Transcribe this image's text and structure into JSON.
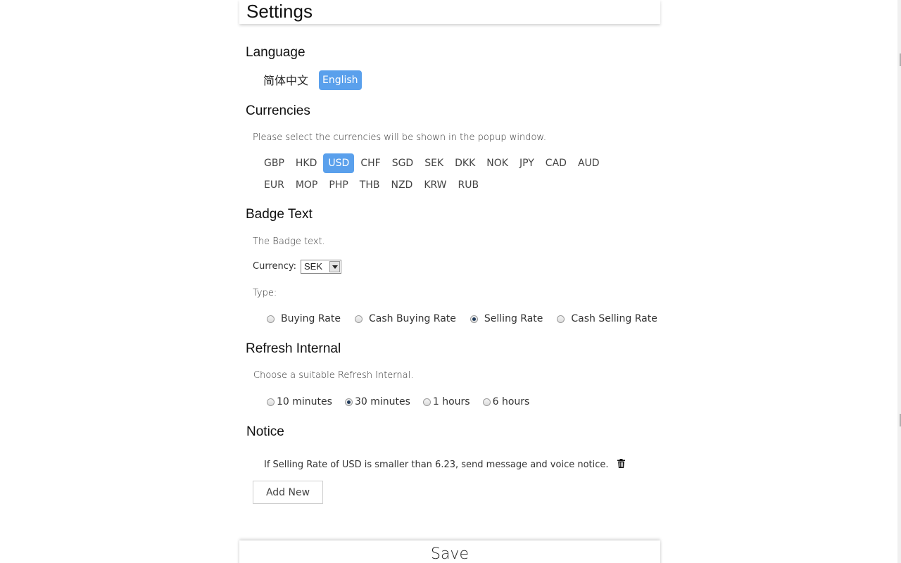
{
  "page": {
    "title": "Settings"
  },
  "language": {
    "title": "Language",
    "options": [
      "简体中文",
      "English"
    ],
    "selected": "English"
  },
  "currencies": {
    "title": "Currencies",
    "description": "Please select the currencies will be shown in the popup window.",
    "row1": [
      "GBP",
      "HKD",
      "USD",
      "CHF",
      "SGD",
      "SEK",
      "DKK",
      "NOK",
      "JPY",
      "CAD",
      "AUD"
    ],
    "row2": [
      "EUR",
      "MOP",
      "PHP",
      "THB",
      "NZD",
      "KRW",
      "RUB"
    ],
    "selected": [
      "USD"
    ]
  },
  "badge": {
    "title": "Badge Text",
    "description": "The Badge text.",
    "currency_label": "Currency:",
    "currency_value": "SEK",
    "type_label": "Type:",
    "types": [
      "Buying Rate",
      "Cash Buying Rate",
      "Selling Rate",
      "Cash Selling Rate"
    ],
    "selected_type": "Selling Rate"
  },
  "refresh": {
    "title": "Refresh Internal",
    "description": "Choose a suitable Refresh Internal.",
    "options": [
      "10 minutes",
      "30 minutes",
      "1 hours",
      "6 hours"
    ],
    "selected": "30 minutes"
  },
  "notice": {
    "title": "Notice",
    "items": [
      "If Selling Rate of USD is smaller than 6.23, send message and voice notice."
    ],
    "add_label": "Add New"
  },
  "save_label": "Save",
  "colors": {
    "accent": "#5aa0ec"
  },
  "icons": {
    "delete": "trash-icon"
  }
}
